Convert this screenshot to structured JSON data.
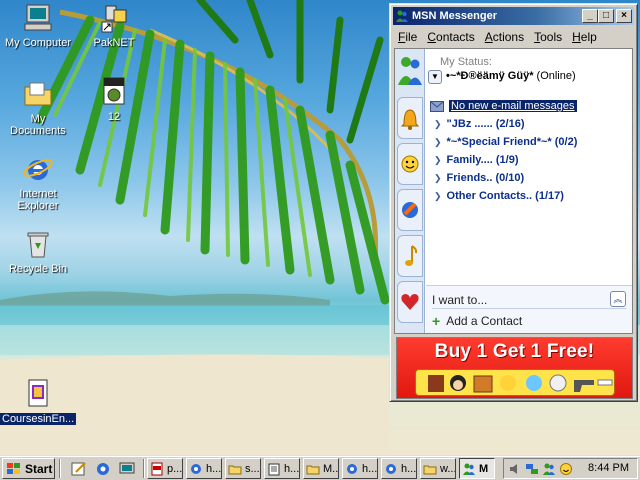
{
  "desktop": {
    "icons": [
      {
        "label": "My Computer",
        "icon": "my-computer-icon"
      },
      {
        "label": "PakNET",
        "icon": "network-shortcut-icon"
      },
      {
        "label": "My Documents",
        "icon": "folder-icon"
      },
      {
        "label": "12",
        "icon": "jpg-image-icon"
      },
      {
        "label": "Internet Explorer",
        "icon": "internet-explorer-icon"
      },
      {
        "label": "Recycle Bin",
        "icon": "recycle-bin-icon"
      },
      {
        "label": "CoursesinEn...",
        "icon": "document-icon"
      }
    ]
  },
  "msn": {
    "title": "MSN Messenger",
    "menu": [
      {
        "label": "File",
        "key": "F",
        "rest": "ile"
      },
      {
        "label": "Contacts",
        "key": "C",
        "rest": "ontacts"
      },
      {
        "label": "Actions",
        "key": "A",
        "rest": "ctions"
      },
      {
        "label": "Tools",
        "key": "T",
        "rest": "ools"
      },
      {
        "label": "Help",
        "key": "H",
        "rest": "elp"
      }
    ],
    "status_label": "My Status:",
    "screen_name": "•~*Ð®ëämÿ Güÿ*",
    "status_value": "(Online)",
    "email_notice": "No new e-mail messages",
    "groups": [
      {
        "label": "\"JBz ...... (2/16)"
      },
      {
        "label": "*~*Special Friend*~* (0/2)"
      },
      {
        "label": "Family.... (1/9)"
      },
      {
        "label": "Friends.. (0/10)"
      },
      {
        "label": "Other Contacts.. (1/17)"
      }
    ],
    "i_want_label": "I want to...",
    "add_contact_label": "Add a Contact",
    "ad_text": "Buy 1 Get 1 Free!",
    "colors": {
      "title_start": "#0a246a",
      "title_end": "#a6caf0",
      "link": "#0b2f8a",
      "ad": "#e0180f"
    }
  },
  "taskbar": {
    "start_label": "Start",
    "buttons": [
      {
        "label": "p...",
        "icon": "pdf-icon"
      },
      {
        "label": "h...",
        "icon": "ie-page-icon"
      },
      {
        "label": "s...",
        "icon": "folder-icon"
      },
      {
        "label": "h...",
        "icon": "notepad-icon"
      },
      {
        "label": "M...",
        "icon": "folder-icon"
      },
      {
        "label": "h...",
        "icon": "ie-page-icon"
      },
      {
        "label": "h...",
        "icon": "ie-page-icon"
      },
      {
        "label": "w...",
        "icon": "folder-icon"
      },
      {
        "label": "M",
        "icon": "msn-icon"
      }
    ],
    "clock": "8:44 PM"
  }
}
